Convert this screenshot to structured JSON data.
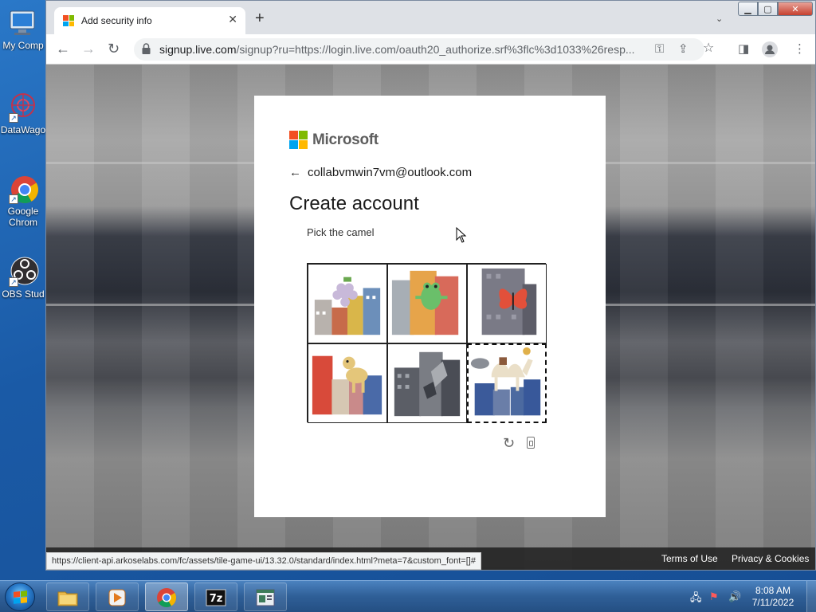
{
  "desktop": {
    "icons": [
      {
        "label": "My Comp"
      },
      {
        "label": "DataWago"
      },
      {
        "label": "Google Chrom"
      },
      {
        "label": "OBS Stud"
      }
    ]
  },
  "browser": {
    "tab_title": "Add security info",
    "url_host": "signup.live.com",
    "url_rest": "/signup?ru=https://login.live.com/oauth20_authorize.srf%3flc%3d1033%26resp...",
    "status_url": "https://client-api.arkoselabs.com/fc/assets/tile-game-ui/13.32.0/standard/index.html?meta=7&custom_font=[]#"
  },
  "card": {
    "brand": "Microsoft",
    "identity": "collabvmwin7vm@outlook.com",
    "heading": "Create account",
    "prompt": "Pick the camel"
  },
  "footer": {
    "terms": "Terms of Use",
    "privacy": "Privacy & Cookies"
  },
  "taskbar": {
    "time": "8:08 AM",
    "date": "7/11/2022"
  },
  "colors": {
    "ms_red": "#f25022",
    "ms_green": "#7fba00",
    "ms_blue": "#00a4ef",
    "ms_yellow": "#ffb900"
  }
}
